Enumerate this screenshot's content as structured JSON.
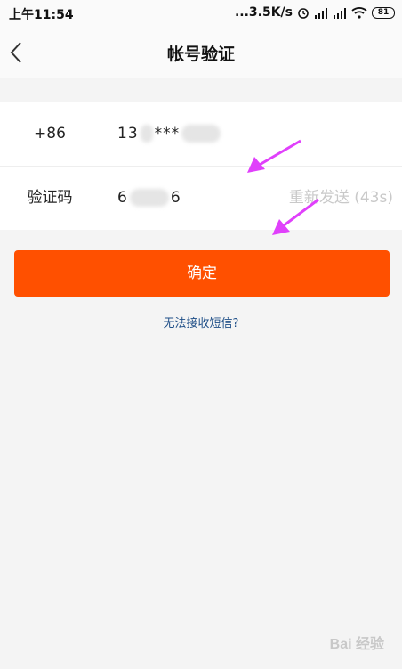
{
  "status_bar": {
    "time": "上午11:54",
    "network_speed": "...3.5K/s",
    "battery": "81",
    "icons": [
      "alarm-icon",
      "hd-signal-icon",
      "signal-icon",
      "wifi-icon",
      "battery-icon"
    ]
  },
  "nav": {
    "title": "帐号验证",
    "back_icon": "chevron-left-icon"
  },
  "form": {
    "country_code": "+86",
    "phone_prefix": "13",
    "phone_mask": "***",
    "code_label": "验证码",
    "code_prefix": "6",
    "code_suffix": "6",
    "resend_label": "重新发送 (43s)"
  },
  "confirm_label": "确定",
  "help_link": "无法接收短信?",
  "watermark": "Bai 经验",
  "colors": {
    "accent": "#ff5000",
    "link": "#1e4e87",
    "annotation_arrow": "#e040fb",
    "disabled_text": "#c9c9c9"
  }
}
